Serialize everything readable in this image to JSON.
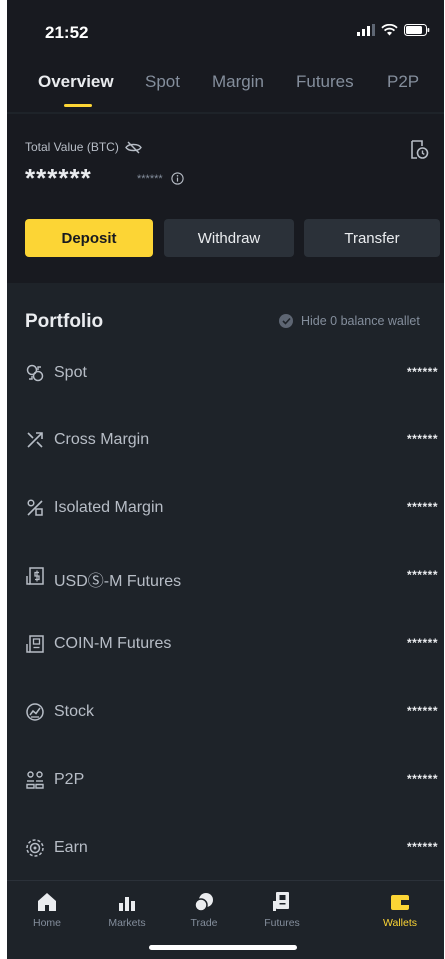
{
  "status_bar": {
    "time": "21:52"
  },
  "tabs": [
    {
      "label": "Overview",
      "active": true
    },
    {
      "label": "Spot"
    },
    {
      "label": "Margin"
    },
    {
      "label": "Futures"
    },
    {
      "label": "P2P"
    }
  ],
  "summary": {
    "total_label": "Total Value (BTC)",
    "total_value": "******",
    "total_sub": "******"
  },
  "actions": {
    "deposit": "Deposit",
    "withdraw": "Withdraw",
    "transfer": "Transfer"
  },
  "portfolio": {
    "title": "Portfolio",
    "hide_zero_label": "Hide 0 balance wallet",
    "items": [
      {
        "label": "Spot",
        "value": "******",
        "icon": "spot-icon"
      },
      {
        "label": "Cross Margin",
        "value": "******",
        "icon": "cross-margin-icon"
      },
      {
        "label": "Isolated Margin",
        "value": "******",
        "icon": "isolated-margin-icon"
      },
      {
        "label": "USDⓈ-M Futures",
        "value": "******",
        "icon": "usd-futures-icon"
      },
      {
        "label": "COIN-M Futures",
        "value": "******",
        "icon": "coin-futures-icon"
      },
      {
        "label": "Stock",
        "value": "******",
        "icon": "stock-icon"
      },
      {
        "label": "P2P",
        "value": "******",
        "icon": "p2p-icon"
      },
      {
        "label": "Earn",
        "value": "******",
        "icon": "earn-icon"
      }
    ]
  },
  "bottom_nav": [
    {
      "label": "Home",
      "icon": "home-icon"
    },
    {
      "label": "Markets",
      "icon": "markets-icon"
    },
    {
      "label": "Trade",
      "icon": "trade-icon"
    },
    {
      "label": "Futures",
      "icon": "futures-icon"
    },
    {
      "label": "Wallets",
      "icon": "wallet-icon",
      "active": true
    }
  ],
  "colors": {
    "accent": "#fcd535",
    "background": "#1e2329",
    "header_background": "#181a20",
    "secondary_button": "#2b3139"
  }
}
